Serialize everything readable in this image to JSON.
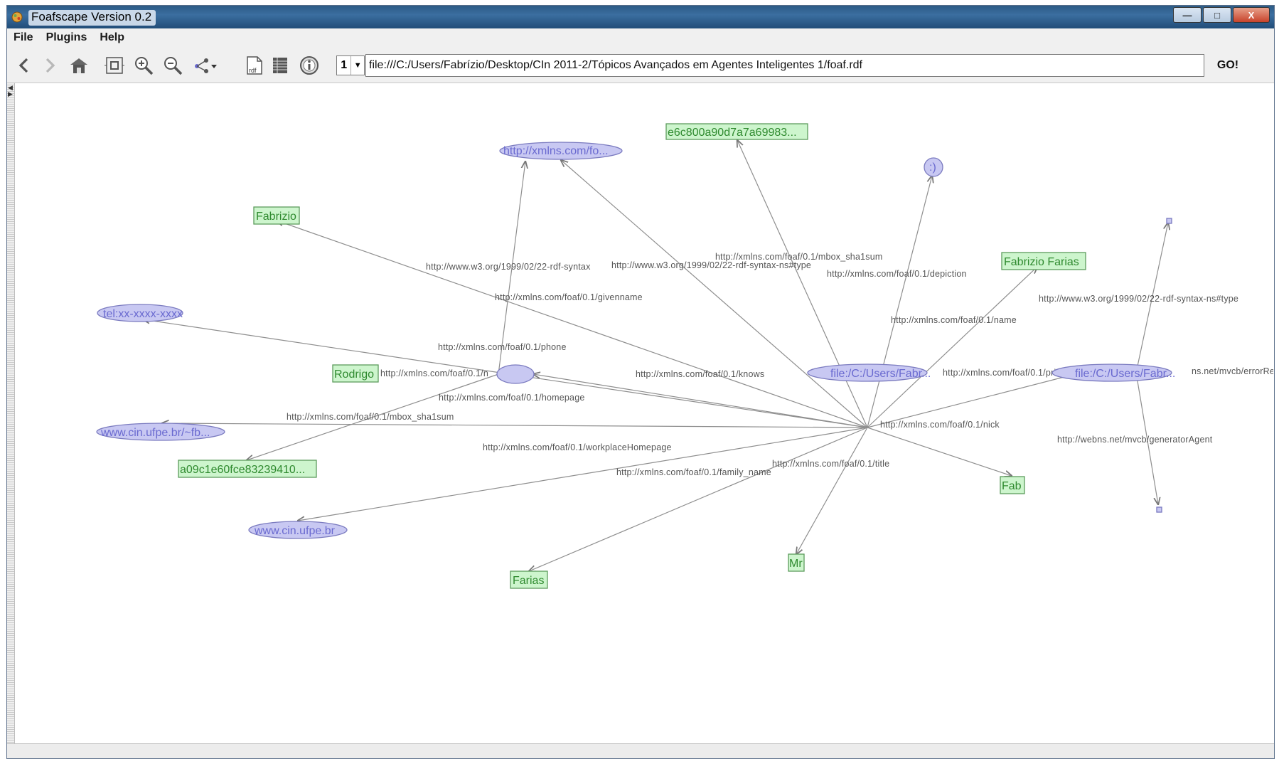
{
  "window": {
    "title": "Foafscape Version 0.2",
    "controls": {
      "minimize": "—",
      "maximize": "□",
      "close": "X"
    }
  },
  "menu": {
    "items": [
      "File",
      "Plugins",
      "Help"
    ]
  },
  "toolbar": {
    "icons": [
      "back-icon",
      "forward-icon",
      "home-icon",
      "fit-view-icon",
      "zoom-in-icon",
      "zoom-out-icon",
      "layout-icon",
      "rdf-document-icon",
      "table-view-icon",
      "info-icon"
    ],
    "rdf_label": "rdf",
    "page_number": "1",
    "url": "file:///C:/Users/Fabrízio/Desktop/CIn 2011-2/Tópicos Avançados em Agentes Inteligentes 1/foaf.rdf",
    "go_label": "GO!"
  },
  "graph": {
    "nodes": [
      {
        "id": "center",
        "kind": "resource",
        "label": "file:/C:/Users/Fabr..."
      },
      {
        "id": "xmlns",
        "kind": "resource",
        "label": "http://xmlns.com/fo..."
      },
      {
        "id": "sha1",
        "kind": "literal",
        "label": "e6c800a90d7a7a69983..."
      },
      {
        "id": "smiley",
        "kind": "resource",
        "label": ":)"
      },
      {
        "id": "fabrizio",
        "kind": "literal",
        "label": "Fabrizio"
      },
      {
        "id": "fabrizio_farias",
        "kind": "literal",
        "label": "Fabrizio Farias"
      },
      {
        "id": "tel",
        "kind": "resource",
        "label": "tel:xx-xxxx-xxxx"
      },
      {
        "id": "rodrigo",
        "kind": "literal",
        "label": "Rodrigo"
      },
      {
        "id": "blank",
        "kind": "resource",
        "label": ""
      },
      {
        "id": "cin_fb",
        "kind": "resource",
        "label": "www.cin.ufpe.br/~fb..."
      },
      {
        "id": "sha1b",
        "kind": "literal",
        "label": "a09c1e60fce83239410..."
      },
      {
        "id": "cin",
        "kind": "resource",
        "label": "www.cin.ufpe.br"
      },
      {
        "id": "farias",
        "kind": "literal",
        "label": "Farias"
      },
      {
        "id": "mr",
        "kind": "literal",
        "label": "Mr"
      },
      {
        "id": "fab",
        "kind": "literal",
        "label": "Fab"
      },
      {
        "id": "right",
        "kind": "resource",
        "label": "file:/C:/Users/Fabr..."
      },
      {
        "id": "sq_top",
        "kind": "square",
        "label": ""
      },
      {
        "id": "sq_bottom",
        "kind": "square",
        "label": ""
      }
    ],
    "edges": [
      {
        "from": "center",
        "to": "fabrizio",
        "label": "http://www.w3.org/1999/02/22-rdf-syntax"
      },
      {
        "from": "center",
        "to": "xmlns",
        "label": "http://www.w3.org/1999/02/22-rdf-syntax-ns#type"
      },
      {
        "from": "center",
        "to": "sha1",
        "label": "http://xmlns.com/foaf/0.1/mbox_sha1sum"
      },
      {
        "from": "center",
        "to": "smiley",
        "label": "http://xmlns.com/foaf/0.1/depiction"
      },
      {
        "from": "center",
        "to": "fabrizio_farias",
        "label": "http://xmlns.com/foaf/0.1/name"
      },
      {
        "from": "center",
        "to": "fabrizio",
        "label": "http://xmlns.com/foaf/0.1/givenname"
      },
      {
        "from": "center",
        "to": "tel",
        "label": "http://xmlns.com/foaf/0.1/phone"
      },
      {
        "from": "center",
        "to": "blank",
        "label": "http://xmlns.com/foaf/0.1/knows"
      },
      {
        "from": "blank",
        "to": "rodrigo",
        "label": "http://xmlns.com/foaf/0.1/n"
      },
      {
        "from": "blank",
        "to": "xmlns",
        "label": ""
      },
      {
        "from": "center",
        "to": "cin_fb",
        "label": "http://xmlns.com/foaf/0.1/homepage"
      },
      {
        "from": "blank",
        "to": "sha1b",
        "label": "http://xmlns.com/foaf/0.1/mbox_sha1sum"
      },
      {
        "from": "center",
        "to": "cin",
        "label": "http://xmlns.com/foaf/0.1/workplaceHomepage"
      },
      {
        "from": "center",
        "to": "farias",
        "label": "http://xmlns.com/foaf/0.1/family_name"
      },
      {
        "from": "center",
        "to": "mr",
        "label": "http://xmlns.com/foaf/0.1/title"
      },
      {
        "from": "center",
        "to": "fab",
        "label": "http://xmlns.com/foaf/0.1/nick"
      },
      {
        "from": "center",
        "to": "right",
        "label": "http://xmlns.com/foaf/0.1/pri"
      },
      {
        "from": "right",
        "to": "sq_top",
        "label": "http://www.w3.org/1999/02/22-rdf-syntax-ns#type"
      },
      {
        "from": "right",
        "to": "sq_bottom",
        "label": "http://webns.net/mvcb/generatorAgent"
      },
      {
        "from": "right",
        "to": "",
        "label": "ns.net/mvcb/errorRe"
      }
    ]
  }
}
